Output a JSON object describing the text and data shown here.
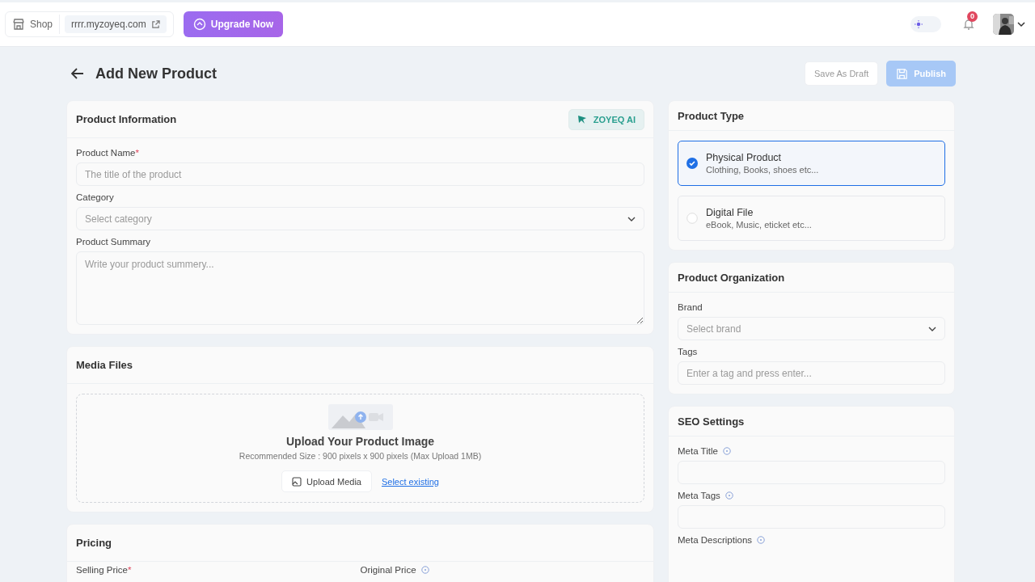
{
  "topbar": {
    "shop_label": "Shop",
    "store_url": "rrrr.myzoyeq.com",
    "upgrade_button": "Upgrade Now",
    "theme_dark": false,
    "notification_count": "0"
  },
  "page": {
    "title": "Add New Product",
    "save_draft": "Save As Draft",
    "publish": "Publish",
    "publish_disabled": true
  },
  "product_information": {
    "title": "Product Information",
    "ai_button": "ZOYEQ AI",
    "fields": [
      {
        "kind": "input",
        "label": "Product Name",
        "required_mark": "*",
        "placeholder": "The title of the product"
      },
      {
        "kind": "select",
        "label": "Category",
        "placeholder": "Select category"
      },
      {
        "kind": "textarea",
        "label": "Product Summary",
        "placeholder": "Write your product summery..."
      }
    ]
  },
  "media_files": {
    "title": "Media Files",
    "heading": "Upload Your Product Image",
    "hint": "Recommended Size : 900 pixels x 900 pixels (Max Upload 1MB)",
    "upload_button": "Upload Media",
    "select_link": "Select existing"
  },
  "pricing": {
    "title": "Pricing",
    "fields": [
      {
        "label": "Selling Price",
        "required_mark": "*",
        "info": false
      },
      {
        "label": "Original Price",
        "info": true
      }
    ]
  },
  "product_type": {
    "title": "Product Type",
    "options": [
      {
        "name": "Physical Product",
        "description": "Clothing, Books, shoes etc...",
        "selected": true
      },
      {
        "name": "Digital File",
        "description": "eBook, Music, eticket etc...",
        "selected": false
      }
    ]
  },
  "product_organization": {
    "title": "Product Organization",
    "fields": [
      {
        "kind": "select",
        "label": "Brand",
        "placeholder": "Select brand"
      },
      {
        "kind": "input",
        "label": "Tags",
        "placeholder": "Enter a tag and press enter..."
      }
    ]
  },
  "seo_settings": {
    "title": "SEO Settings",
    "fields": [
      {
        "kind": "input",
        "label": "Meta Title",
        "info": true
      },
      {
        "kind": "input",
        "label": "Meta Tags",
        "info": true
      },
      {
        "kind": "label",
        "label": "Meta Descriptions",
        "info": true
      }
    ]
  }
}
